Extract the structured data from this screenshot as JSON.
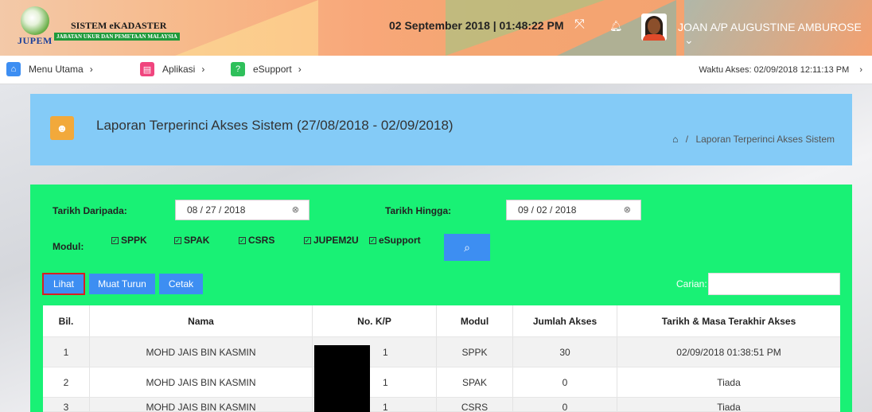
{
  "header": {
    "logo_text": "JUPEM",
    "brand_title": "SISTEM eKADASTER",
    "brand_subtitle": "JABATAN UKUR DAN PEMETAAN MALAYSIA",
    "datetime": "02 September 2018 | 01:48:22 PM",
    "fullscreen_glyph": "⤧",
    "bell_glyph": "🔔︎",
    "username": "JOAN A/P AUGUSTINE AMBUROSE",
    "user_chevron": "⌄",
    "icons": [
      "fullscreen-icon",
      "bell-icon",
      "chevron-down-icon"
    ]
  },
  "navbar": {
    "items": [
      {
        "label": "Menu Utama",
        "badge_glyph": "⌂",
        "color": "#3d8ef2",
        "chevron": "›"
      },
      {
        "label": "Aplikasi",
        "badge_glyph": "▤",
        "color": "#f0457e",
        "chevron": "›"
      },
      {
        "label": "eSupport",
        "badge_glyph": "?",
        "color": "#2fc05b",
        "chevron": "›"
      }
    ],
    "access_time": "Waktu Akses: 02/09/2018 12:11:13 PM",
    "access_chevron": "›"
  },
  "title_panel": {
    "icon_glyph": "☻",
    "title": "Laporan Terperinci Akses Sistem (27/08/2018 - 02/09/2018)",
    "home_glyph": "⌂",
    "breadcrumb_sep": "/",
    "breadcrumb": "Laporan Terperinci Akses Sistem"
  },
  "filters": {
    "from_label": "Tarikh Daripada:",
    "from_value": "08 / 27 / 2018",
    "to_label": "Tarikh Hingga:",
    "to_value": "09 / 02 / 2018",
    "clear_glyph": "⊗",
    "modul_label": "Modul:",
    "check_glyph": "✓",
    "modules": [
      "SPPK",
      "SPAK",
      "CSRS",
      "JUPEM2U",
      "eSupport"
    ],
    "search_glyph": "⌕"
  },
  "actions": {
    "lihat": "Lihat",
    "muat_turun": "Muat Turun",
    "cetak": "Cetak",
    "carian_label": "Carian:"
  },
  "table": {
    "headers": [
      "Bil.",
      "Nama",
      "No. K/P",
      "Modul",
      "Jumlah Akses",
      "Tarikh & Masa Terakhir Akses"
    ],
    "rows": [
      {
        "bil": "1",
        "nama": "MOHD JAIS BIN KASMIN",
        "kp": "1",
        "modul": "SPPK",
        "jumlah": "30",
        "tarikh": "02/09/2018 01:38:51 PM"
      },
      {
        "bil": "2",
        "nama": "MOHD JAIS BIN KASMIN",
        "kp": "1",
        "modul": "SPAK",
        "jumlah": "0",
        "tarikh": "Tiada"
      },
      {
        "bil": "3",
        "nama": "MOHD JAIS BIN KASMIN",
        "kp": "1",
        "modul": "CSRS",
        "jumlah": "0",
        "tarikh": "Tiada"
      }
    ]
  }
}
